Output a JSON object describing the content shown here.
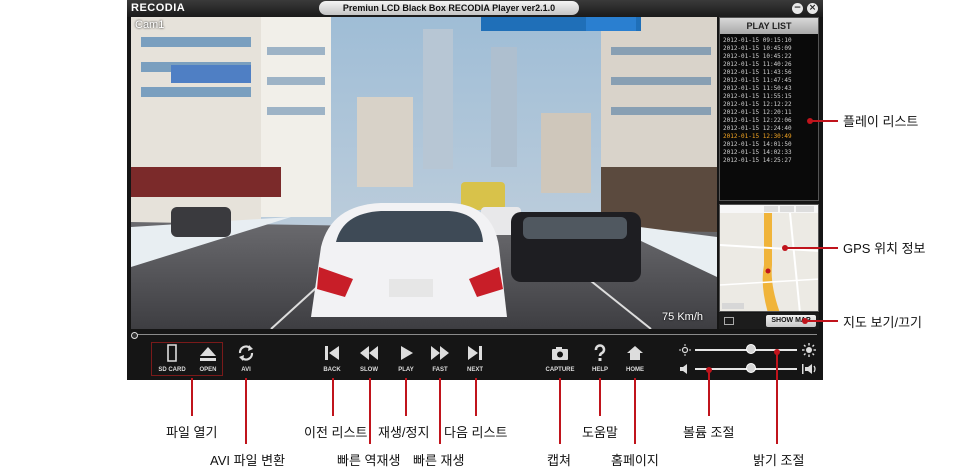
{
  "window": {
    "logo": "RECODIA",
    "title": "Premiun LCD Black Box RECODIA Player  ver2.1.0",
    "minimize_symbol": "−",
    "close_symbol": "×"
  },
  "video": {
    "camera_label": "Cam1",
    "speed": "75 Km/h",
    "progress_fraction": 0.0
  },
  "playlist": {
    "title": "PLAY LIST",
    "items": [
      "2012-01-15  09:15:10",
      "2012-01-15  10:45:09",
      "2012-01-15  10:45:22",
      "2012-01-15  11:40:26",
      "2012-01-15  11:43:56",
      "2012-01-15  11:47:45",
      "2012-01-15  11:50:43",
      "2012-01-15  11:55:15",
      "2012-01-15  12:12:22",
      "2012-01-15  12:20:11",
      "2012-01-15  12:22:06",
      "2012-01-15  12:24:40",
      "2012-01-15  12:30:49",
      "2012-01-15  14:01:50",
      "2012-01-15  14:02:33",
      "2012-01-15  14:25:27"
    ],
    "active_index": 12
  },
  "map": {
    "show_map_label": "SHOW MAP"
  },
  "controls": {
    "sd_card": "SD CARD",
    "open": "OPEN",
    "avi": "AVI",
    "back": "BACK",
    "slow": "SLOW",
    "play": "PLAY",
    "fast": "FAST",
    "next": "NEXT",
    "capture": "CAPTURE",
    "help": "HELP",
    "home": "HOME"
  },
  "sliders": {
    "brightness_level": 0.55,
    "volume_level": 0.55
  },
  "annotations": {
    "playlist": "플레이 리스트",
    "gps": "GPS 위치 정보",
    "map_toggle": "지도 보기/끄기",
    "file_open": "파일 열기",
    "avi_convert": "AVI 파일 변환",
    "prev_list": "이전 리스트",
    "reverse": "빠른 역재생",
    "play_stop": "재생/정지",
    "fast_play": "빠른 재생",
    "next_list": "다음 리스트",
    "capture": "캡쳐",
    "help": "도움말",
    "home": "홈페이지",
    "volume": "볼륨 조절",
    "brightness": "밝기 조절"
  },
  "colors": {
    "app_bg": "#151515",
    "annotation_red": "#c0141c",
    "active_item": "#f5a623"
  }
}
